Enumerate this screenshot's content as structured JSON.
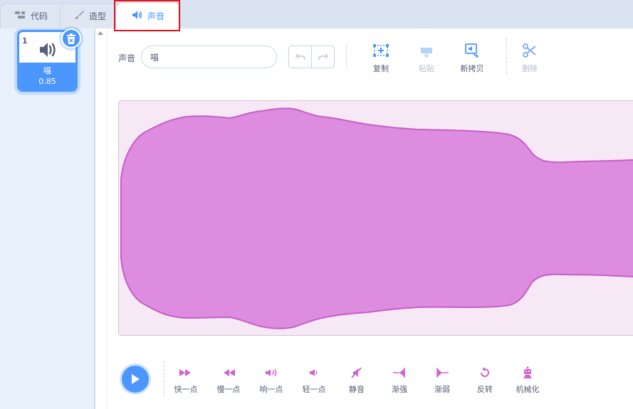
{
  "tabs": [
    {
      "label": "代码",
      "icon": "code-icon"
    },
    {
      "label": "造型",
      "icon": "brush-icon"
    },
    {
      "label": "声音",
      "icon": "speaker-icon",
      "active": true
    }
  ],
  "sounds": [
    {
      "index": "1",
      "name": "喵",
      "duration": "0.85",
      "selected": true
    }
  ],
  "editor": {
    "name_label": "声音",
    "name_value": "喵",
    "tools": [
      {
        "label": "复制",
        "icon": "copy-icon",
        "enabled": true
      },
      {
        "label": "粘贴",
        "icon": "paste-icon",
        "enabled": false
      },
      {
        "label": "新拷贝",
        "icon": "copy-to-new-icon",
        "enabled": true
      },
      {
        "label": "删除",
        "icon": "delete-icon",
        "enabled": false
      }
    ]
  },
  "effects": [
    {
      "label": "快一点",
      "icon": "faster-icon"
    },
    {
      "label": "慢一点",
      "icon": "slower-icon"
    },
    {
      "label": "响一点",
      "icon": "louder-icon"
    },
    {
      "label": "轻一点",
      "icon": "softer-icon"
    },
    {
      "label": "静音",
      "icon": "mute-icon"
    },
    {
      "label": "渐强",
      "icon": "fade-in-icon"
    },
    {
      "label": "渐弱",
      "icon": "fade-out-icon"
    },
    {
      "label": "反转",
      "icon": "reverse-icon"
    },
    {
      "label": "机械化",
      "icon": "robot-icon"
    }
  ],
  "colors": {
    "accent": "#4c97ff",
    "waveform_fill": "#de8cdf",
    "waveform_stroke": "#c45fc7",
    "effect_icon": "#cf63cf",
    "highlight": "#e6111b"
  }
}
